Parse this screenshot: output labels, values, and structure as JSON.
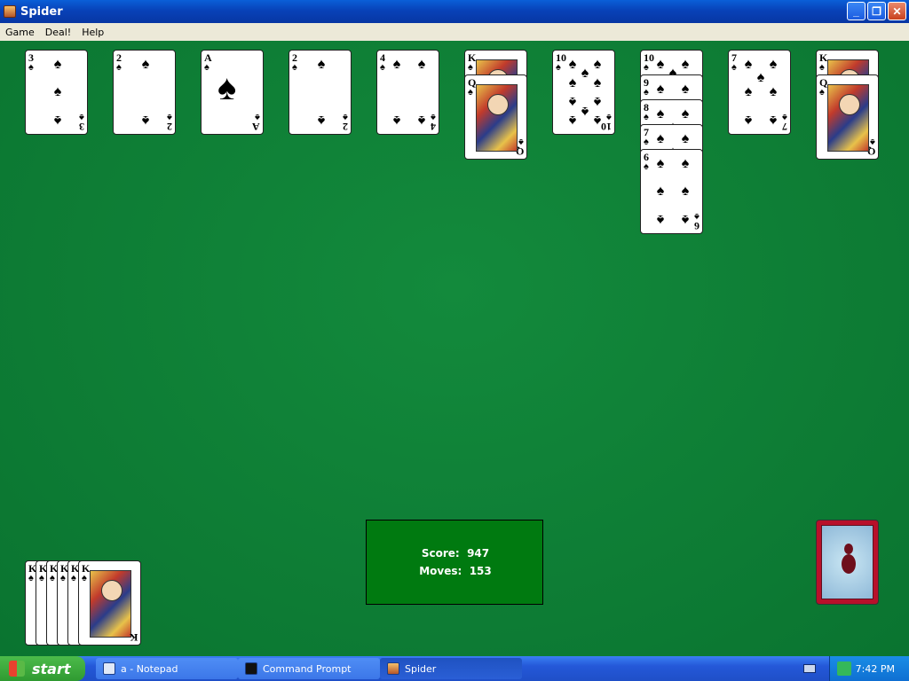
{
  "window": {
    "title": "Spider"
  },
  "menu": [
    "Game",
    "Deal!",
    "Help"
  ],
  "tableau": [
    {
      "cards": [
        {
          "rank": "3",
          "suit": "♠"
        }
      ]
    },
    {
      "cards": [
        {
          "rank": "2",
          "suit": "♠"
        }
      ]
    },
    {
      "cards": [
        {
          "rank": "A",
          "suit": "♠"
        }
      ]
    },
    {
      "cards": [
        {
          "rank": "2",
          "suit": "♠"
        }
      ]
    },
    {
      "cards": [
        {
          "rank": "4",
          "suit": "♠"
        }
      ]
    },
    {
      "cards": [
        {
          "rank": "K",
          "suit": "♠"
        },
        {
          "rank": "Q",
          "suit": "♠"
        }
      ]
    },
    {
      "cards": [
        {
          "rank": "10",
          "suit": "♠"
        }
      ]
    },
    {
      "cards": [
        {
          "rank": "10",
          "suit": "♠"
        },
        {
          "rank": "9",
          "suit": "♠"
        },
        {
          "rank": "8",
          "suit": "♠"
        },
        {
          "rank": "7",
          "suit": "♠"
        },
        {
          "rank": "6",
          "suit": "♠"
        }
      ]
    },
    {
      "cards": [
        {
          "rank": "7",
          "suit": "♠"
        }
      ]
    },
    {
      "cards": [
        {
          "rank": "K",
          "suit": "♠"
        },
        {
          "rank": "Q",
          "suit": "♠"
        }
      ]
    }
  ],
  "completed": {
    "ranks": [
      "K",
      "K",
      "K",
      "K",
      "K",
      "K"
    ],
    "suit": "♠"
  },
  "score": {
    "score_label": "Score:",
    "score_value": "947",
    "moves_label": "Moves:",
    "moves_value": "153"
  },
  "taskbar": {
    "start_label": "start",
    "tasks": [
      {
        "label": "a - Notepad",
        "icon": "notepad-icon"
      },
      {
        "label": "Command Prompt",
        "icon": "cmd-icon"
      },
      {
        "label": "Spider",
        "icon": "spider-icon"
      }
    ],
    "clock": "7:42 PM"
  }
}
